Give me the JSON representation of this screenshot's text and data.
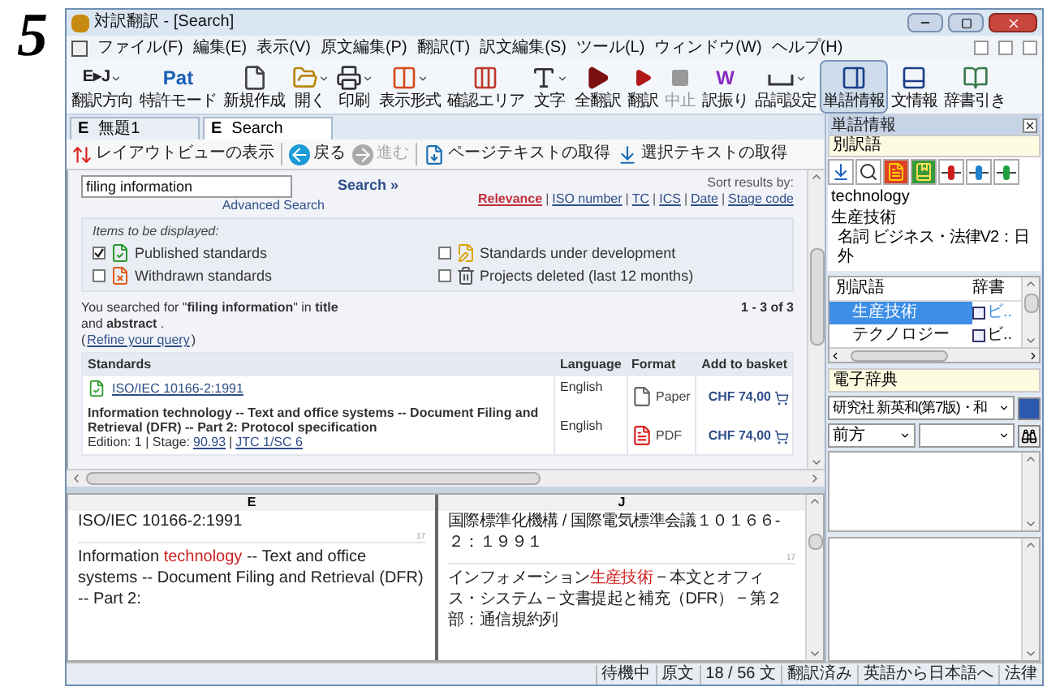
{
  "figure_label": "5",
  "window": {
    "title": "対訳翻訳 - [Search]"
  },
  "menu": [
    "ファイル(F)",
    "編集(E)",
    "表示(V)",
    "原文編集(P)",
    "翻訳(T)",
    "訳文編集(S)",
    "ツール(L)",
    "ウィンドウ(W)",
    "ヘルプ(H)"
  ],
  "toolbar": [
    {
      "label": "翻訳方向",
      "icon_text": "E▸J",
      "dropdown": true,
      "selected": false,
      "disabled": false
    },
    {
      "label": "特許モード",
      "icon_text": "Pat",
      "dropdown": false,
      "selected": false,
      "disabled": false
    },
    {
      "label": "新規作成",
      "dropdown": false,
      "selected": false,
      "disabled": false
    },
    {
      "label": "開く",
      "dropdown": true,
      "selected": false,
      "disabled": false
    },
    {
      "label": "印刷",
      "dropdown": true,
      "selected": false,
      "disabled": false
    },
    {
      "label": "表示形式",
      "dropdown": true,
      "selected": false,
      "disabled": false
    },
    {
      "label": "確認エリア",
      "dropdown": false,
      "selected": false,
      "disabled": false
    },
    {
      "label": "文字",
      "dropdown": true,
      "selected": false,
      "disabled": false
    },
    {
      "label": "全翻訳",
      "dropdown": false,
      "selected": false,
      "disabled": false
    },
    {
      "label": "翻訳",
      "dropdown": false,
      "selected": false,
      "disabled": false
    },
    {
      "label": "中止",
      "dropdown": false,
      "selected": false,
      "disabled": true
    },
    {
      "label": "訳振り",
      "icon_text": "W",
      "dropdown": false,
      "selected": false,
      "disabled": false
    },
    {
      "label": "品詞設定",
      "dropdown": true,
      "selected": false,
      "disabled": false
    },
    {
      "label": "単語情報",
      "dropdown": false,
      "selected": true,
      "disabled": false
    },
    {
      "label": "文情報",
      "dropdown": false,
      "selected": false,
      "disabled": false
    },
    {
      "label": "辞書引き",
      "dropdown": false,
      "selected": false,
      "disabled": false
    }
  ],
  "doc_tabs": [
    {
      "prefix": "E",
      "label": "無題1",
      "selected": false
    },
    {
      "prefix": "E",
      "label": "Search",
      "selected": true
    }
  ],
  "browser_toolbar": [
    {
      "label": "レイアウトビューの表示",
      "disabled": false
    },
    {
      "label": "戻る",
      "disabled": false
    },
    {
      "label": "進む",
      "disabled": true
    },
    {
      "label": "ページテキストの取得",
      "disabled": false
    },
    {
      "label": "選択テキストの取得",
      "disabled": false
    }
  ],
  "web": {
    "search": {
      "value": "filing information",
      "advanced": "Advanced Search",
      "button": "Search »"
    },
    "sort": {
      "label": "Sort results by:",
      "separator": "|",
      "options": [
        {
          "label": "Relevance",
          "selected": true
        },
        {
          "label": "ISO number",
          "selected": false
        },
        {
          "label": "TC",
          "selected": false
        },
        {
          "label": "ICS",
          "selected": false
        },
        {
          "label": "Date",
          "selected": false
        },
        {
          "label": "Stage code",
          "selected": false
        }
      ]
    },
    "filter": {
      "title": "Items to be displayed:",
      "items": [
        {
          "label": "Published standards",
          "checked": true,
          "kind": "published"
        },
        {
          "label": "Standards under development",
          "checked": false,
          "kind": "development"
        },
        {
          "label": "Withdrawn standards",
          "checked": false,
          "kind": "withdrawn"
        },
        {
          "label": "Projects deleted (last 12 months)",
          "checked": false,
          "kind": "deleted"
        }
      ]
    },
    "summary": "You searched for \"**filing information**\" in **title** and **abstract** .",
    "count": "1 - 3 of 3",
    "refine": {
      "open": "(",
      "link": "Refine your query",
      "close": ")"
    },
    "table": {
      "columns": [
        "Standards",
        "Language",
        "Format",
        "Add to basket"
      ],
      "rows": [
        {
          "code": "ISO/IEC 10166-2:1991",
          "title": "Information technology -- Text and office systems -- Document Filing and Retrieval (DFR) -- Part 2: Protocol specification",
          "edition": [
            {
              "text": "Edition: 1 | Stage:",
              "link": false
            },
            {
              "text": "90.93",
              "link": true
            },
            {
              "text": "|",
              "link": false
            },
            {
              "text": "JTC 1/SC 6",
              "link": true
            }
          ],
          "offers": [
            {
              "language": "English",
              "format": "Paper",
              "kind": "paper",
              "price": "CHF 74,00"
            },
            {
              "language": "English",
              "format": "PDF",
              "kind": "pdf",
              "price": "CHF 74,00"
            }
          ]
        }
      ]
    }
  },
  "panes": [
    {
      "header": "E",
      "segments": [
        {
          "parts": [
            {
              "text": "ISO/IEC 10166-2:1991",
              "highlight": false
            }
          ],
          "end_marker": "17"
        },
        {
          "parts": [
            {
              "text": "Information ",
              "highlight": false
            },
            {
              "text": "technology",
              "highlight": true
            },
            {
              "text": " -- Text and office systems -- Document Filing and Retrieval (DFR) -- Part 2:",
              "highlight": false
            }
          ]
        }
      ]
    },
    {
      "header": "J",
      "segments": [
        {
          "parts": [
            {
              "text": "国際標準化機構 / 国際電気標準会議１０１６６-２：１９９１",
              "highlight": false
            }
          ],
          "end_marker": "17"
        },
        {
          "parts": [
            {
              "text": "インフォメーション",
              "highlight": false
            },
            {
              "text": "生産技術",
              "highlight": true
            },
            {
              "text": " − 本文とオフィス・システム − 文書提起と補充（DFR） − 第２部：通信規約列",
              "highlight": false
            }
          ]
        }
      ]
    }
  ],
  "word_panel": {
    "title": "単語情報",
    "section": "別訳語",
    "word": "technology",
    "translation": "生産技術",
    "info": "名詞 ビジネス・法律V2：日外",
    "list": {
      "columns": [
        "別訳語",
        "辞書"
      ],
      "rows": [
        {
          "term": "生産技術",
          "dict": "ビ..",
          "selected": true
        },
        {
          "term": "テクノロジー",
          "dict": "ビ..",
          "selected": false
        }
      ]
    }
  },
  "dictionary": {
    "title": "電子辞典",
    "dict_select": "研究社 新英和(第7版)・和",
    "mode_select": "前方"
  },
  "status_bar": [
    "待機中",
    "原文",
    "18 / 56 文",
    "翻訳済み",
    "英語から日本語へ",
    "法律"
  ]
}
